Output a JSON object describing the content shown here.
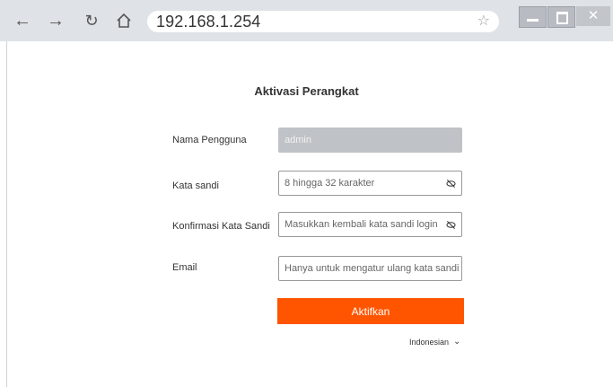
{
  "browser": {
    "url": "192.168.1.254",
    "back_icon": "arrow-left-icon",
    "forward_icon": "arrow-right-icon",
    "reload_icon": "reload-icon",
    "home_icon": "home-icon",
    "bookmark_icon": "star-icon"
  },
  "form": {
    "title": "Aktivasi Perangkat",
    "username_label": "Nama Pengguna",
    "username_value": "admin",
    "password_label": "Kata sandi",
    "password_placeholder": "8 hingga 32 karakter",
    "confirm_label": "Konfirmasi Kata Sandi",
    "confirm_placeholder": "Masukkan kembali kata sandi login",
    "email_label": "Email",
    "email_placeholder": "Hanya untuk mengatur ulang kata sandi",
    "submit_label": "Aktifkan"
  },
  "language": {
    "selected": "Indonesian"
  },
  "colors": {
    "accent": "#ff5500",
    "chrome": "#dfe2e6",
    "disabled_field": "#bfc2c6"
  }
}
